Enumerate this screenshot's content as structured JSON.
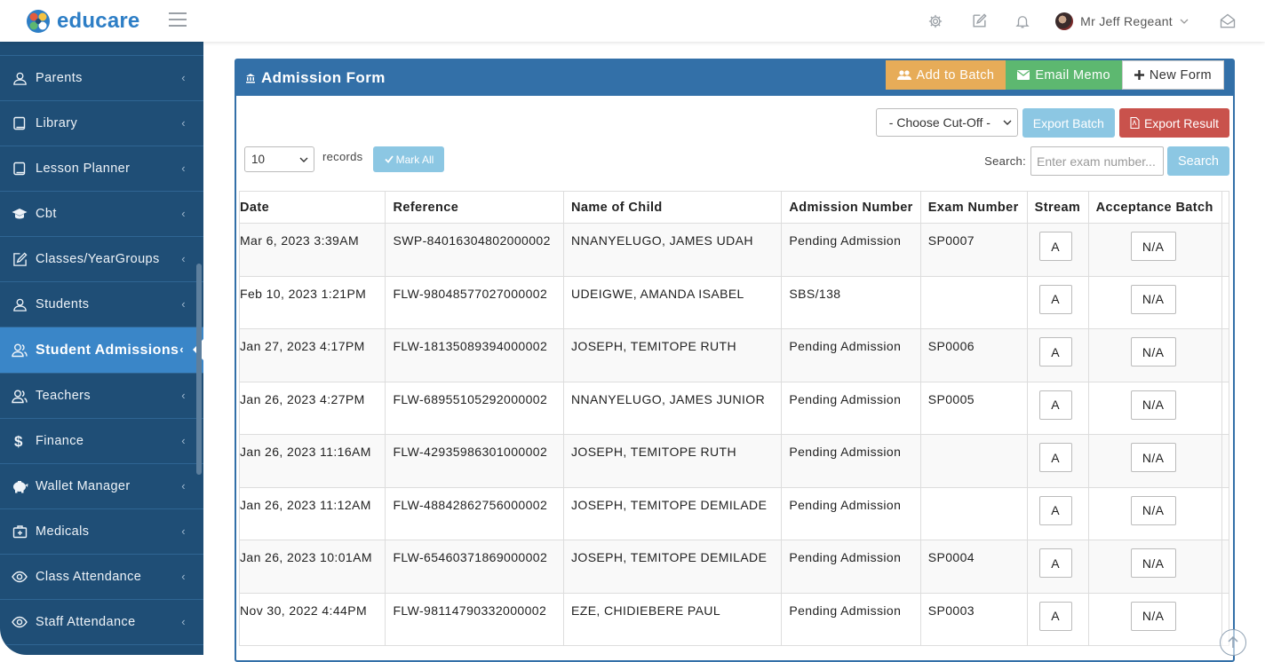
{
  "app": {
    "logo_text": "educare"
  },
  "header": {
    "user_name": "Mr Jeff Regeant"
  },
  "sidebar": {
    "items": [
      {
        "label": "Parents",
        "icon": "user-icon"
      },
      {
        "label": "Library",
        "icon": "book-icon"
      },
      {
        "label": "Lesson Planner",
        "icon": "book-icon"
      },
      {
        "label": "Cbt",
        "icon": "graduation-cap-icon"
      },
      {
        "label": "Classes/YearGroups",
        "icon": "edit-icon"
      },
      {
        "label": "Students",
        "icon": "user-icon"
      },
      {
        "label": "Student Admissions",
        "icon": "users-icon",
        "active": true
      },
      {
        "label": "Teachers",
        "icon": "users-icon"
      },
      {
        "label": "Finance",
        "icon": "dollar-icon"
      },
      {
        "label": "Wallet Manager",
        "icon": "piggy-bank-icon"
      },
      {
        "label": "Medicals",
        "icon": "medkit-icon"
      },
      {
        "label": "Class Attendance",
        "icon": "eye-icon"
      },
      {
        "label": "Staff Attendance",
        "icon": "eye-icon"
      }
    ]
  },
  "panel": {
    "title": "Admission Form",
    "buttons": {
      "add_to_batch": "Add to Batch",
      "email_memo": "Email Memo",
      "new_form": "New Form"
    },
    "cutoff_select": "- Choose Cut-Off -",
    "export_batch": "Export Batch",
    "export_result": "Export Result",
    "records_select": "10",
    "records_label": "records",
    "mark_all": "Mark All",
    "search_label": "Search:",
    "search_placeholder": "Enter exam number...",
    "search_button": "Search"
  },
  "table": {
    "columns": [
      "Date",
      "Reference",
      "Name of Child",
      "Admission Number",
      "Exam Number",
      "Stream",
      "Acceptance Batch"
    ],
    "rows": [
      {
        "date": "Mar 6, 2023 3:39AM",
        "reference": "SWP-84016304802000002",
        "name": "NNANYELUGO, JAMES UDAH",
        "admission": "Pending Admission",
        "exam": "SP0007",
        "stream": "A",
        "batch": "N/A"
      },
      {
        "date": "Feb 10, 2023 1:21PM",
        "reference": "FLW-98048577027000002",
        "name": "UDEIGWE, AMANDA ISABEL",
        "admission": "SBS/138",
        "exam": "",
        "stream": "A",
        "batch": "N/A"
      },
      {
        "date": "Jan 27, 2023 4:17PM",
        "reference": "FLW-18135089394000002",
        "name": "JOSEPH, TEMITOPE RUTH",
        "admission": "Pending Admission",
        "exam": "SP0006",
        "stream": "A",
        "batch": "N/A"
      },
      {
        "date": "Jan 26, 2023 4:27PM",
        "reference": "FLW-68955105292000002",
        "name": "NNANYELUGO, JAMES JUNIOR",
        "admission": "Pending Admission",
        "exam": "SP0005",
        "stream": "A",
        "batch": "N/A"
      },
      {
        "date": "Jan 26, 2023 11:16AM",
        "reference": "FLW-42935986301000002",
        "name": "JOSEPH, TEMITOPE RUTH",
        "admission": "Pending Admission",
        "exam": "",
        "stream": "A",
        "batch": "N/A"
      },
      {
        "date": "Jan 26, 2023 11:12AM",
        "reference": "FLW-48842862756000002",
        "name": "JOSEPH, TEMITOPE DEMILADE",
        "admission": "Pending Admission",
        "exam": "",
        "stream": "A",
        "batch": "N/A"
      },
      {
        "date": "Jan 26, 2023 10:01AM",
        "reference": "FLW-65460371869000002",
        "name": "JOSEPH, TEMITOPE DEMILADE",
        "admission": "Pending Admission",
        "exam": "SP0004",
        "stream": "A",
        "batch": "N/A"
      },
      {
        "date": "Nov 30, 2022 4:44PM",
        "reference": "FLW-98114790332000002",
        "name": "EZE, CHIDIEBERE PAUL",
        "admission": "Pending Admission",
        "exam": "SP0003",
        "stream": "A",
        "batch": "N/A"
      }
    ]
  },
  "colors": {
    "sidebar_bg": "#1f4e76",
    "sidebar_active": "#3a86c8",
    "panel_header": "#3370a8",
    "btn_orange": "#e7ac58",
    "btn_green": "#5db870",
    "btn_light_blue": "#8cc7e3",
    "btn_red": "#c9524c",
    "logo_blue": "#2d7ec6"
  }
}
